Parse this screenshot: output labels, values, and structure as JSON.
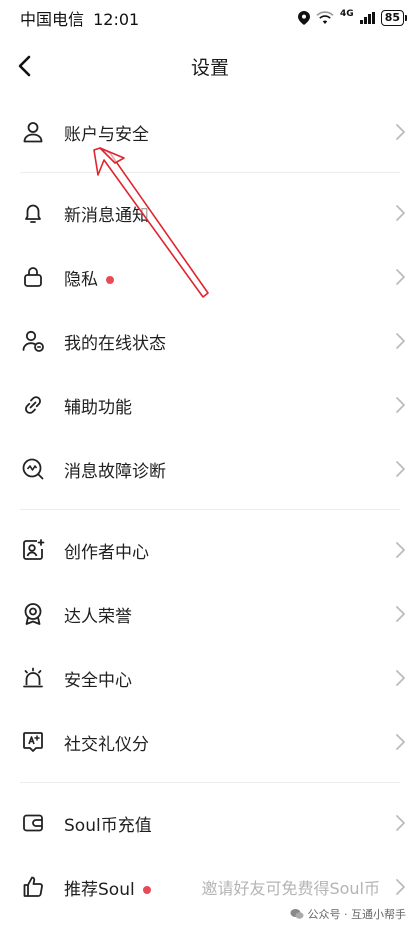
{
  "status_bar": {
    "carrier": "中国电信",
    "time": "12:01",
    "network": "4G",
    "battery": "85"
  },
  "header": {
    "title": "设置"
  },
  "groups": [
    {
      "items": [
        {
          "label": "账户与安全",
          "icon": "user-icon"
        }
      ]
    },
    {
      "items": [
        {
          "label": "新消息通知",
          "icon": "bell-icon"
        },
        {
          "label": "隐私",
          "icon": "lock-icon",
          "dot": true
        },
        {
          "label": "我的在线状态",
          "icon": "user-status-icon"
        },
        {
          "label": "辅助功能",
          "icon": "link-icon"
        },
        {
          "label": "消息故障诊断",
          "icon": "diagnosis-icon"
        }
      ]
    },
    {
      "items": [
        {
          "label": "创作者中心",
          "icon": "creator-icon"
        },
        {
          "label": "达人荣誉",
          "icon": "medal-icon"
        },
        {
          "label": "安全中心",
          "icon": "alarm-icon"
        },
        {
          "label": "社交礼仪分",
          "icon": "etiquette-icon"
        }
      ]
    },
    {
      "items": [
        {
          "label": "Soul币充值",
          "icon": "wallet-icon"
        },
        {
          "label": "推荐Soul",
          "icon": "thumbs-up-icon",
          "dot": true,
          "sub": "邀请好友可免费得Soul币"
        }
      ]
    }
  ],
  "watermark": "公众号 · 互通小帮手",
  "colors": {
    "dot": "#e94a57",
    "annotation_arrow": "#e0252f"
  }
}
